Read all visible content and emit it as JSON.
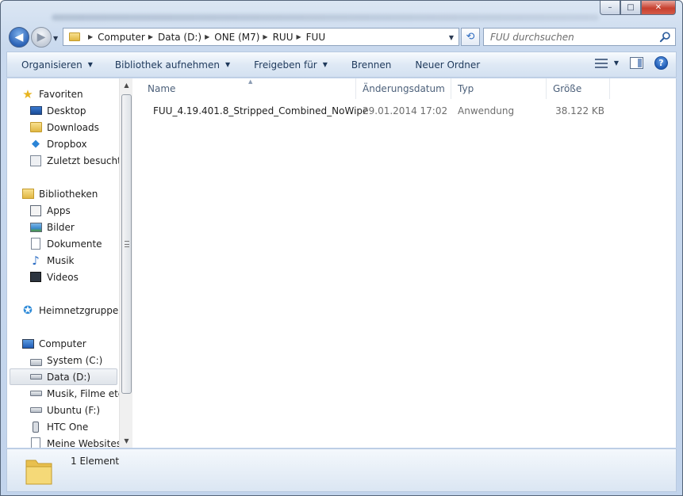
{
  "window": {
    "controls": {
      "minimize": "–",
      "maximize": "□",
      "close": "✕"
    }
  },
  "address": {
    "crumbs": [
      "Computer",
      "Data (D:)",
      "ONE (M7)",
      "RUU",
      "FUU"
    ]
  },
  "search": {
    "placeholder": "FUU durchsuchen"
  },
  "toolbar": {
    "organize": "Organisieren",
    "include_library": "Bibliothek aufnehmen",
    "share": "Freigeben für",
    "burn": "Brennen",
    "new_folder": "Neuer Ordner",
    "help": "?"
  },
  "sidebar": {
    "favorites": {
      "title": "Favoriten",
      "items": [
        "Desktop",
        "Downloads",
        "Dropbox",
        "Zuletzt besucht"
      ]
    },
    "libraries": {
      "title": "Bibliotheken",
      "items": [
        "Apps",
        "Bilder",
        "Dokumente",
        "Musik",
        "Videos"
      ]
    },
    "homegroup": {
      "title": "Heimnetzgruppe"
    },
    "computer": {
      "title": "Computer",
      "items": [
        "System (C:)",
        "Data (D:)",
        "Musik, Filme etc.",
        "Ubuntu (F:)",
        "HTC One",
        "Meine Websites a"
      ],
      "selected": "Data (D:)"
    }
  },
  "columns": {
    "name": "Name",
    "date": "Änderungsdatum",
    "type": "Typ",
    "size": "Größe"
  },
  "files": [
    {
      "name": "FUU_4.19.401.8_Stripped_Combined_NoWipe",
      "date": "29.01.2014 17:02",
      "type": "Anwendung",
      "size": "38.122 KB"
    }
  ],
  "status": {
    "count_text": "1 Element"
  },
  "colors": {
    "accent": "#2c63b7",
    "folder": "#e8c04f",
    "header_text": "#4c607a",
    "toolbar_text": "#1e395b"
  }
}
